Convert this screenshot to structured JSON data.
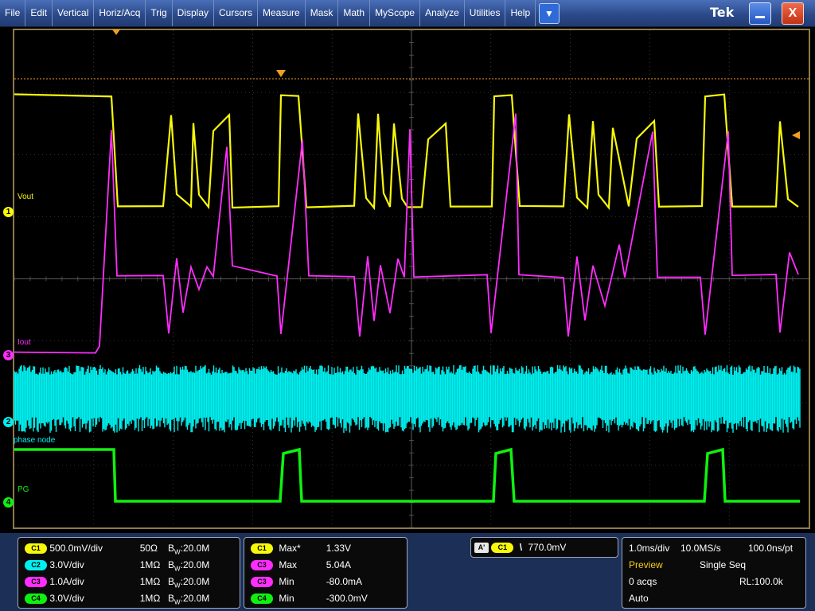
{
  "menubar": {
    "items": [
      "File",
      "Edit",
      "Vertical",
      "Horiz/Acq",
      "Trig",
      "Display",
      "Cursors",
      "Measure",
      "Mask",
      "Math",
      "MyScope",
      "Analyze",
      "Utilities",
      "Help"
    ],
    "dropdown_glyph": "▼",
    "brand": "Tek",
    "close_glyph": "X"
  },
  "colors": {
    "ch1": "#f8f80a",
    "ch2": "#00f0f0",
    "ch3": "#ff2dff",
    "ch4": "#10f010",
    "trigger_marker": "#f0a020",
    "graticule": "#5a5a5a",
    "frame": "#8f7a4c"
  },
  "channels": [
    {
      "marker": "1",
      "label": "Vout"
    },
    {
      "marker": "3",
      "label": "Iout"
    },
    {
      "marker": "2",
      "label": "phase node"
    },
    {
      "marker": "4",
      "label": "PG"
    }
  ],
  "vertical_settings": [
    {
      "badge": "C1",
      "scale": "500.0mV/div",
      "impedance": "50Ω",
      "bw_prefix": "B",
      "bw_sub": "W",
      "bw": ":20.0M"
    },
    {
      "badge": "C2",
      "scale": "3.0V/div",
      "impedance": "1MΩ",
      "bw_prefix": "B",
      "bw_sub": "W",
      "bw": ":20.0M"
    },
    {
      "badge": "C3",
      "scale": "1.0A/div",
      "impedance": "1MΩ",
      "bw_prefix": "B",
      "bw_sub": "W",
      "bw": ":20.0M"
    },
    {
      "badge": "C4",
      "scale": "3.0V/div",
      "impedance": "1MΩ",
      "bw_prefix": "B",
      "bw_sub": "W",
      "bw": ":20.0M"
    }
  ],
  "measurements": [
    {
      "badge": "C1",
      "name": "Max*",
      "value": "1.33V"
    },
    {
      "badge": "C3",
      "name": "Max",
      "value": "5.04A"
    },
    {
      "badge": "C3",
      "name": "Min",
      "value": "-80.0mA"
    },
    {
      "badge": "C4",
      "name": "Min",
      "value": "-300.0mV"
    }
  ],
  "trigger": {
    "mode_badge": "A'",
    "source_badge": "C1",
    "slope_glyph": "\\",
    "level": "770.0mV"
  },
  "horizontal": {
    "scale": "1.0ms/div",
    "sample_rate": "10.0MS/s",
    "resolution": "100.0ns/pt",
    "state": "Preview",
    "seq": "Single Seq",
    "acqs": "0 acqs",
    "record_length": "RL:100.0k",
    "trigger_mode": "Auto"
  }
}
